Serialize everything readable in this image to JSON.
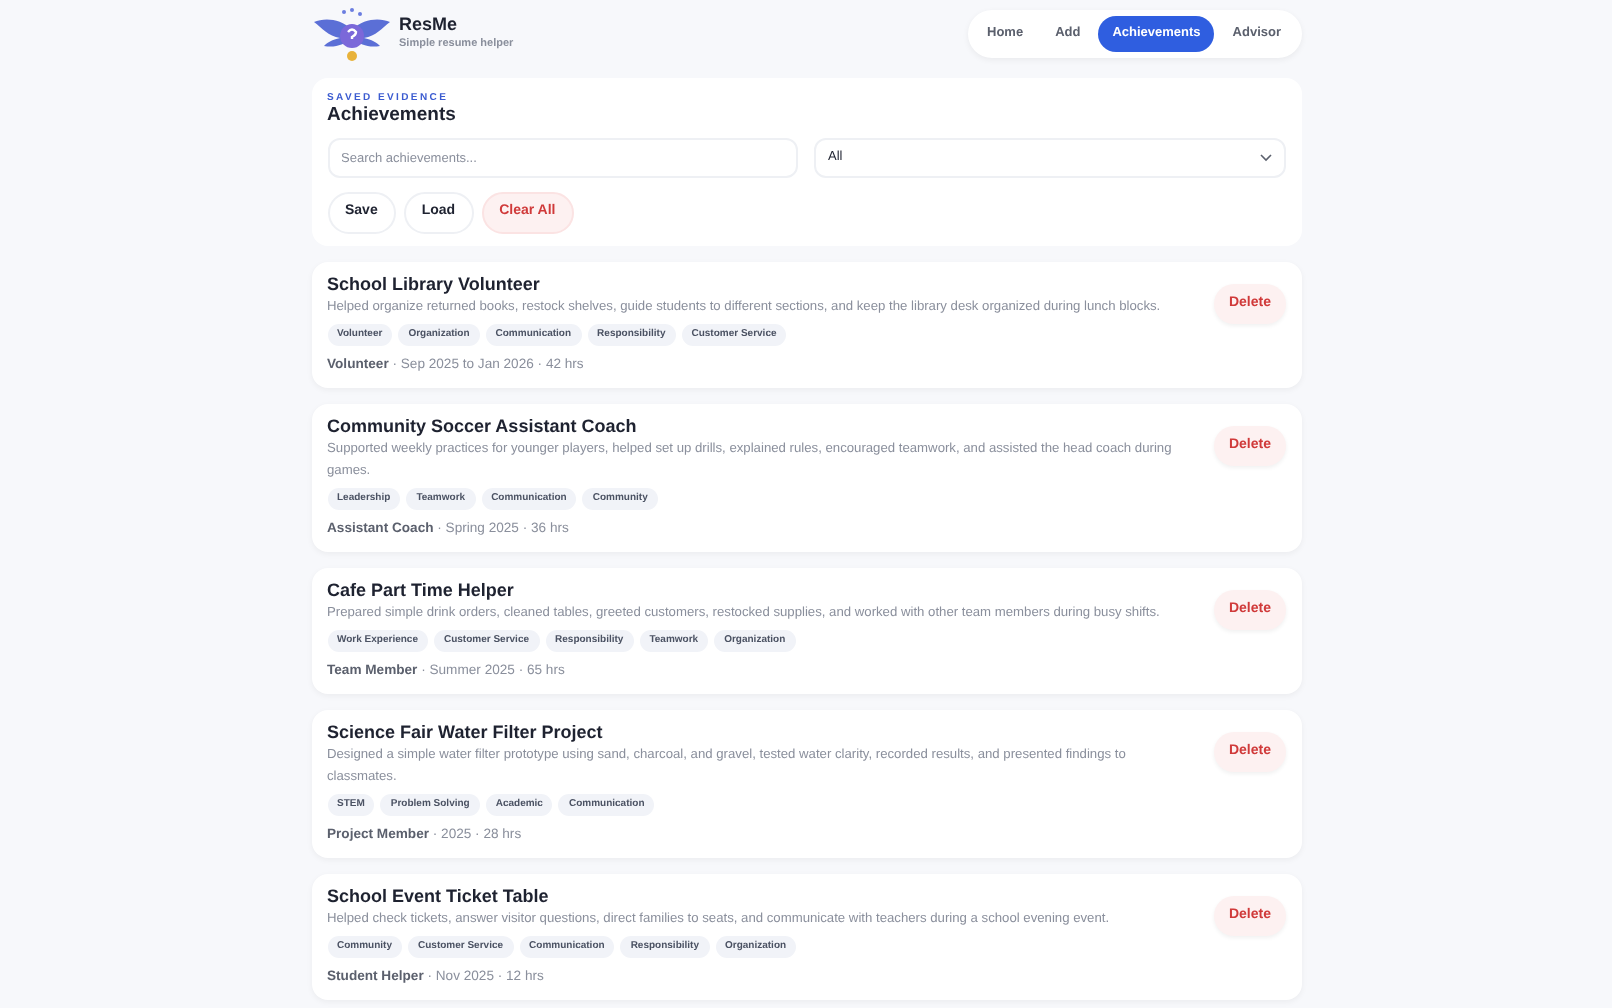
{
  "brand": {
    "name": "ResMe",
    "tagline": "Simple resume helper"
  },
  "nav": [
    {
      "label": "Home",
      "selected": false
    },
    {
      "label": "Add",
      "selected": false
    },
    {
      "label": "Achievements",
      "selected": true
    },
    {
      "label": "Advisor",
      "selected": false
    }
  ],
  "panel": {
    "eyebrow": "SAVED EVIDENCE",
    "title": "Achievements",
    "search": {
      "placeholder": "Search achievements..."
    },
    "filter": {
      "value": "All"
    },
    "buttons": [
      {
        "label": "Save",
        "kind": "plain"
      },
      {
        "label": "Load",
        "kind": "plain"
      },
      {
        "label": "Clear All",
        "kind": "danger"
      }
    ]
  },
  "achievements": [
    {
      "title": "School Library Volunteer",
      "description": "Helped organize returned books, restock shelves, guide students to different sections, and keep the library desk organized during lunch blocks.",
      "tags": [
        "Volunteer",
        "Organization",
        "Communication",
        "Responsibility",
        "Customer Service"
      ],
      "meta": "**Volunteer** · Sep 2025 to Jan 2026 · 42 hrs",
      "action": "Delete"
    },
    {
      "title": "Community Soccer Assistant Coach",
      "description": "Supported weekly practices for younger players, helped set up drills, explained rules, encouraged teamwork, and assisted the head coach during games.",
      "tags": [
        "Leadership",
        "Teamwork",
        "Communication",
        "Community"
      ],
      "meta": "**Assistant Coach** · Spring 2025 · 36 hrs",
      "action": "Delete"
    },
    {
      "title": "Cafe Part Time Helper",
      "description": "Prepared simple drink orders, cleaned tables, greeted customers, restocked supplies, and worked with other team members during busy shifts.",
      "tags": [
        "Work Experience",
        "Customer Service",
        "Responsibility",
        "Teamwork",
        "Organization"
      ],
      "meta": "**Team Member** · Summer 2025 · 65 hrs",
      "action": "Delete"
    },
    {
      "title": "Science Fair Water Filter Project",
      "description": "Designed a simple water filter prototype using sand, charcoal, and gravel, tested water clarity, recorded results, and presented findings to classmates.",
      "tags": [
        "STEM",
        "Problem Solving",
        "Academic",
        "Communication"
      ],
      "meta": "**Project Member** · 2025 · 28 hrs",
      "action": "Delete"
    },
    {
      "title": "School Event Ticket Table",
      "description": "Helped check tickets, answer visitor questions, direct families to seats, and communicate with teachers during a school evening event.",
      "tags": [
        "Community",
        "Customer Service",
        "Communication",
        "Responsibility",
        "Organization"
      ],
      "meta": "**Student Helper** · Nov 2025 · 12 hrs",
      "action": "Delete"
    }
  ]
}
